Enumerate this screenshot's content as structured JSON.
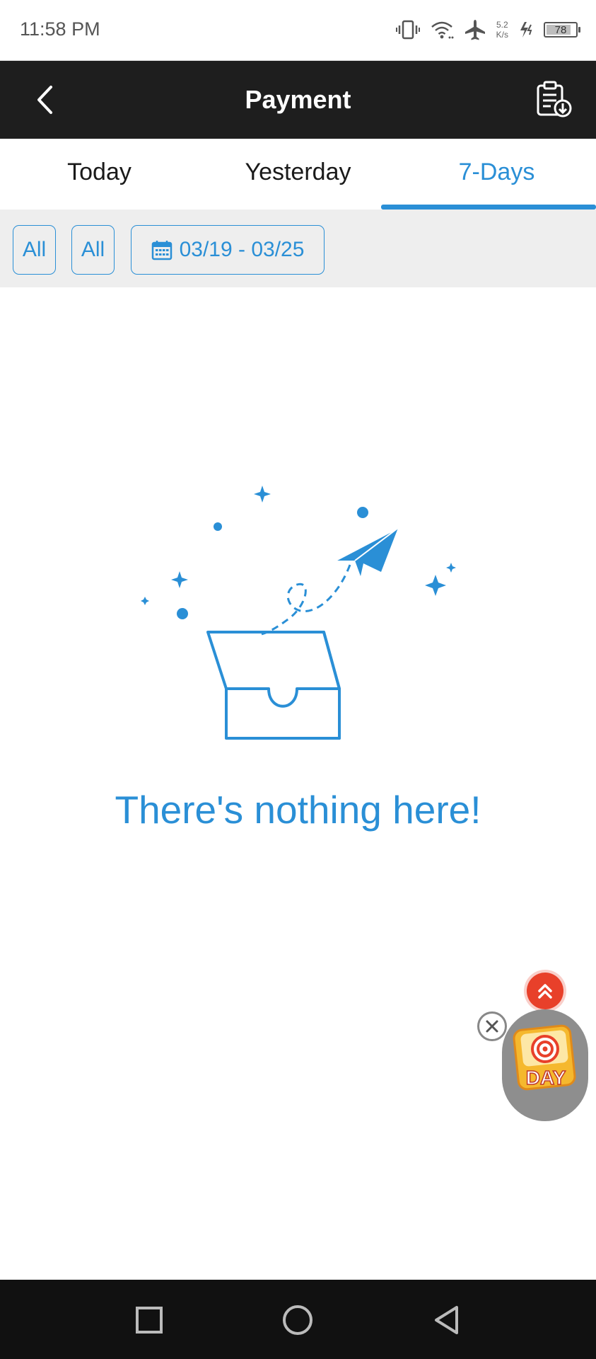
{
  "status_bar": {
    "time": "11:58 PM",
    "net_speed_value": "5.2",
    "net_speed_unit": "K/s",
    "battery_level": "78"
  },
  "header": {
    "title": "Payment"
  },
  "tabs": [
    {
      "label": "Today",
      "active": false
    },
    {
      "label": "Yesterday",
      "active": false
    },
    {
      "label": "7-Days",
      "active": true
    }
  ],
  "filters": {
    "type_label": "All",
    "status_label": "All",
    "date_range": "03/19 - 03/25"
  },
  "empty_state": {
    "message": "There's nothing here!"
  },
  "promo_widget": {
    "badge_text": "DAY"
  },
  "colors": {
    "accent": "#2a8fd6",
    "header_bg": "#1e1e1e",
    "filter_bg": "#eeeeee",
    "nav_bg": "#111111",
    "fab_red": "#e8402a"
  },
  "icons": {
    "back": "chevron-left-icon",
    "records": "clipboard-download-icon",
    "calendar": "calendar-icon",
    "empty": "inbox-paper-plane-icon",
    "scroll_top": "double-chevron-up-icon",
    "close": "close-icon"
  }
}
